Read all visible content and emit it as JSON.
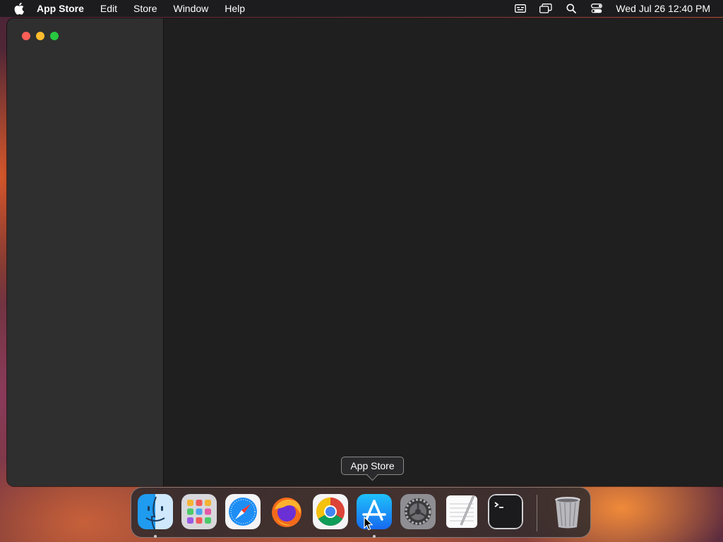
{
  "menubar": {
    "app_name": "App Store",
    "items": [
      "Edit",
      "Store",
      "Window",
      "Help"
    ],
    "clock": "Wed Jul 26  12:40 PM",
    "status_icons": [
      "keyboard-input-icon",
      "screen-mirroring-icon",
      "spotlight-search-icon",
      "control-center-icon"
    ]
  },
  "window": {
    "traffic_lights": [
      "close",
      "minimize",
      "zoom"
    ]
  },
  "tooltip": {
    "label": "App Store"
  },
  "dock": {
    "items": [
      "Finder",
      "Launchpad",
      "Safari",
      "Firefox",
      "Google Chrome",
      "App Store",
      "System Settings",
      "TextEdit",
      "Terminal",
      "Trash"
    ],
    "running": [
      "Finder",
      "App Store"
    ]
  },
  "colors": {
    "menubar_bg": "#1c1c1e",
    "sidebar_bg": "#2f2f2f",
    "content_bg": "#1f1f1f",
    "close": "#ff5f57",
    "minimize": "#febc2e",
    "zoom": "#28c840"
  }
}
